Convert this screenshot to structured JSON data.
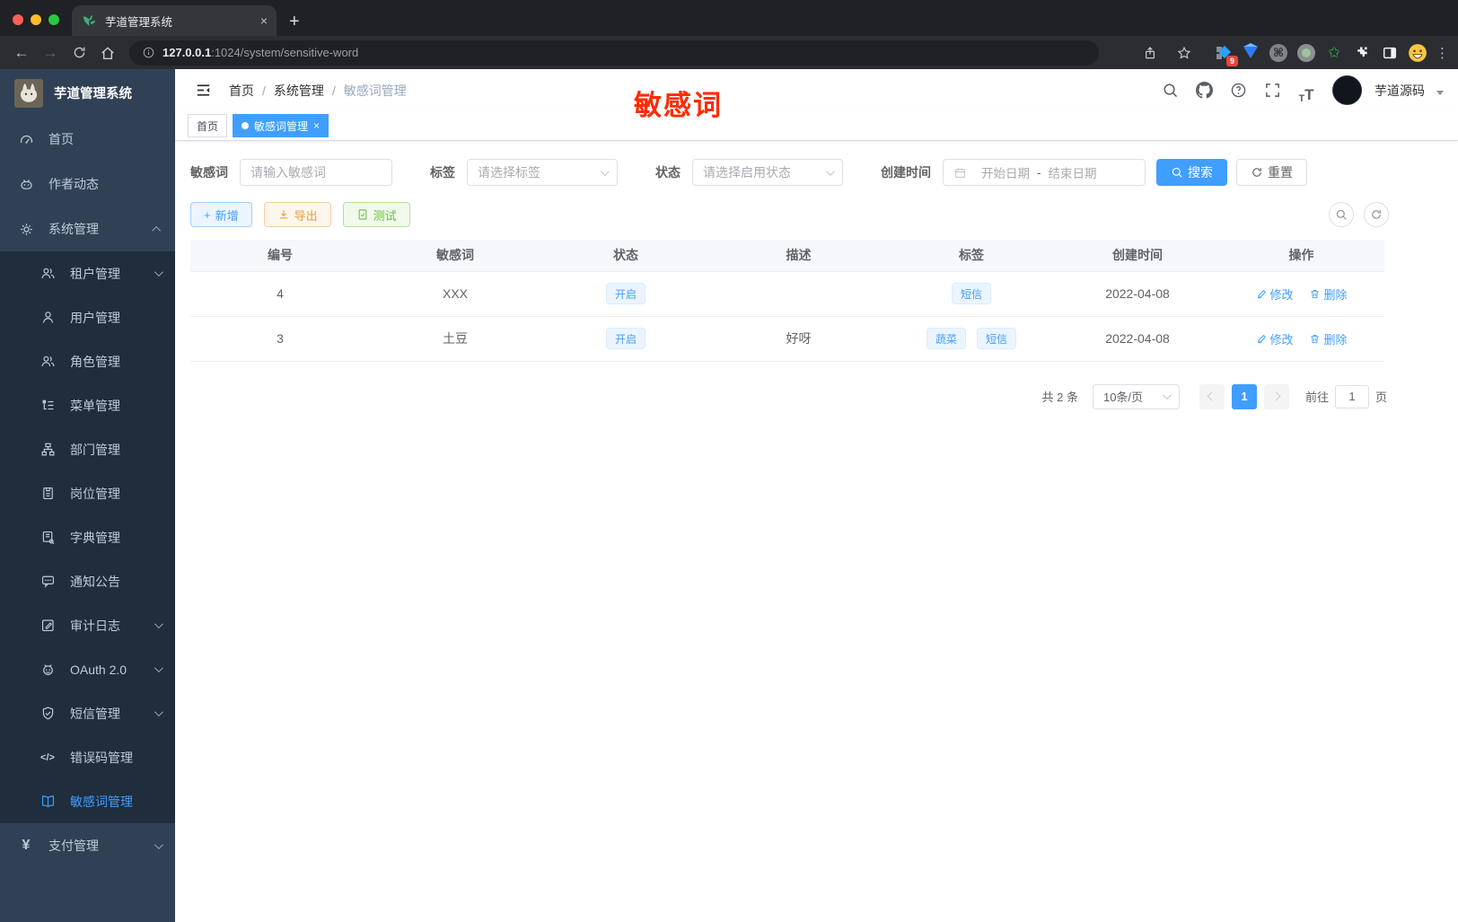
{
  "browser": {
    "tab_title": "芋道管理系统",
    "url_host": "127.0.0.1",
    "url_rest": ":1024/system/sensitive-word",
    "extension_badge": "9",
    "traffic_colors": {
      "close": "#ff5f57",
      "minimize": "#febc2e",
      "zoom": "#28c840"
    }
  },
  "icons": {
    "plus": "+",
    "close": "×",
    "back": "←",
    "forward": "→",
    "dots": "⋮",
    "command": "⌘",
    "code": "</>",
    "yen": "¥",
    "question": "?",
    "t_small": "T",
    "t_big": "T",
    "date_sep": "-",
    "green_star": "✩"
  },
  "sidebar": {
    "app_title": "芋道管理系统",
    "items": [
      {
        "label": "首页"
      },
      {
        "label": "作者动态"
      },
      {
        "label": "系统管理"
      },
      {
        "label": "租户管理"
      },
      {
        "label": "用户管理"
      },
      {
        "label": "角色管理"
      },
      {
        "label": "菜单管理"
      },
      {
        "label": "部门管理"
      },
      {
        "label": "岗位管理"
      },
      {
        "label": "字典管理"
      },
      {
        "label": "通知公告"
      },
      {
        "label": "审计日志"
      },
      {
        "label": "OAuth 2.0"
      },
      {
        "label": "短信管理"
      },
      {
        "label": "错误码管理"
      },
      {
        "label": "敏感词管理"
      },
      {
        "label": "支付管理"
      }
    ]
  },
  "header": {
    "breadcrumb": [
      "首页",
      "系统管理",
      "敏感词管理"
    ],
    "separator": "/",
    "username": "芋道源码"
  },
  "tags_view": {
    "tabs": [
      {
        "label": "首页"
      },
      {
        "label": "敏感词管理"
      }
    ]
  },
  "annotation": {
    "text": "敏感词",
    "color": "#fe2b00"
  },
  "filter": {
    "keyword_label": "敏感词",
    "keyword_placeholder": "请输入敏感词",
    "tag_label": "标签",
    "tag_placeholder": "请选择标签",
    "status_label": "状态",
    "status_placeholder": "请选择启用状态",
    "date_label": "创建时间",
    "date_start_placeholder": "开始日期",
    "date_end_placeholder": "结束日期",
    "search_label": "搜索",
    "reset_label": "重置"
  },
  "toolbar": {
    "add_label": "新增",
    "export_label": "导出",
    "test_label": "测试"
  },
  "table": {
    "columns": [
      "编号",
      "敏感词",
      "状态",
      "描述",
      "标签",
      "创建时间",
      "操作"
    ],
    "edit_label": "修改",
    "delete_label": "删除",
    "rows": [
      {
        "id": "4",
        "word": "XXX",
        "status": "开启",
        "description": "",
        "tags": [
          "短信"
        ],
        "created": "2022-04-08"
      },
      {
        "id": "3",
        "word": "土豆",
        "status": "开启",
        "description": "好呀",
        "tags": [
          "蔬菜",
          "短信"
        ],
        "created": "2022-04-08"
      }
    ]
  },
  "pagination": {
    "total": "共 2 条",
    "page_size": "10条/页",
    "current_page": "1",
    "goto_label": "前往",
    "goto_value": "1",
    "page_unit": "页"
  },
  "colors": {
    "primary": "#409eff",
    "success": "#67c23a",
    "warning": "#e6a23c",
    "sidebar_bg": "#304156",
    "submenu_bg": "#1f2d3d"
  }
}
